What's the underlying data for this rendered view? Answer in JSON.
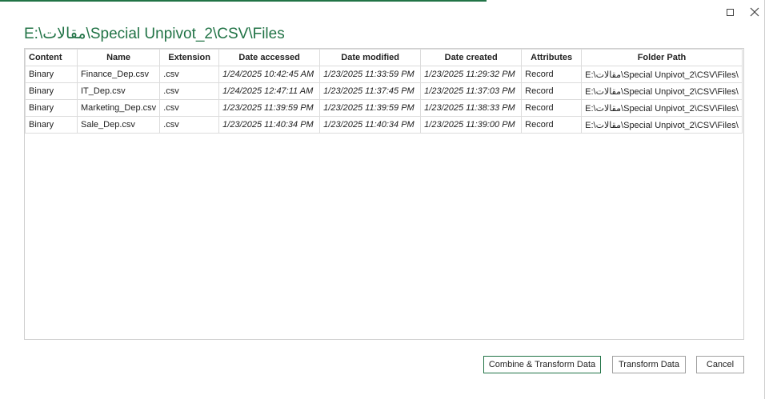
{
  "window": {
    "title": "E:\\مقالات\\Special Unpivot_2\\CSV\\Files",
    "accent_color": "#217346",
    "maximize_icon": "maximize-icon",
    "close_icon": "close-icon"
  },
  "table": {
    "columns": [
      "Content",
      "Name",
      "Extension",
      "Date accessed",
      "Date modified",
      "Date created",
      "Attributes",
      "Folder Path"
    ],
    "rows": [
      {
        "content": "Binary",
        "name": "Finance_Dep.csv",
        "extension": ".csv",
        "date_accessed": "1/24/2025 10:42:45 AM",
        "date_modified": "1/23/2025 11:33:59 PM",
        "date_created": "1/23/2025 11:29:32 PM",
        "attributes": "Record",
        "folder_path": "E:\\مقالات\\Special Unpivot_2\\CSV\\Files\\"
      },
      {
        "content": "Binary",
        "name": "IT_Dep.csv",
        "extension": ".csv",
        "date_accessed": "1/24/2025 12:47:11 AM",
        "date_modified": "1/23/2025 11:37:45 PM",
        "date_created": "1/23/2025 11:37:03 PM",
        "attributes": "Record",
        "folder_path": "E:\\مقالات\\Special Unpivot_2\\CSV\\Files\\"
      },
      {
        "content": "Binary",
        "name": "Marketing_Dep.csv",
        "extension": ".csv",
        "date_accessed": "1/23/2025 11:39:59 PM",
        "date_modified": "1/23/2025 11:39:59 PM",
        "date_created": "1/23/2025 11:38:33 PM",
        "attributes": "Record",
        "folder_path": "E:\\مقالات\\Special Unpivot_2\\CSV\\Files\\"
      },
      {
        "content": "Binary",
        "name": "Sale_Dep.csv",
        "extension": ".csv",
        "date_accessed": "1/23/2025 11:40:34 PM",
        "date_modified": "1/23/2025 11:40:34 PM",
        "date_created": "1/23/2025 11:39:00 PM",
        "attributes": "Record",
        "folder_path": "E:\\مقالات\\Special Unpivot_2\\CSV\\Files\\"
      }
    ]
  },
  "buttons": {
    "combine": "Combine & Transform Data",
    "transform": "Transform Data",
    "cancel": "Cancel"
  }
}
